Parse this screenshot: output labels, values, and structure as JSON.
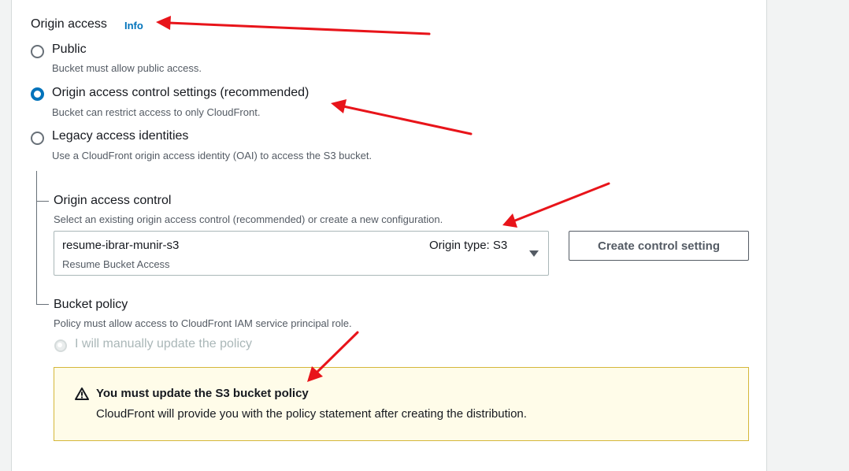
{
  "origin_access": {
    "title": "Origin access",
    "info_link": "Info",
    "options": [
      {
        "label": "Public",
        "description": "Bucket must allow public access.",
        "selected": false
      },
      {
        "label": "Origin access control settings (recommended)",
        "description": "Bucket can restrict access to only CloudFront.",
        "selected": true
      },
      {
        "label": "Legacy access identities",
        "description": "Use a CloudFront origin access identity (OAI) to access the S3 bucket.",
        "selected": false
      }
    ]
  },
  "origin_access_control": {
    "title": "Origin access control",
    "description": "Select an existing origin access control (recommended) or create a new configuration.",
    "select": {
      "value": "resume-ibrar-munir-s3",
      "subtext": "Resume Bucket Access",
      "meta": "Origin type: S3"
    },
    "create_button": "Create control setting"
  },
  "bucket_policy": {
    "title": "Bucket policy",
    "description": "Policy must allow access to CloudFront IAM service principal role.",
    "option_label": "I will manually update the policy"
  },
  "alert": {
    "title": "You must update the S3 bucket policy",
    "body": "CloudFront will provide you with the policy statement after creating the distribution."
  },
  "colors": {
    "accent": "#0073bb",
    "annotation_arrow": "#e8141a",
    "warning_background": "#fffce9",
    "warning_border": "#d5b73a"
  }
}
